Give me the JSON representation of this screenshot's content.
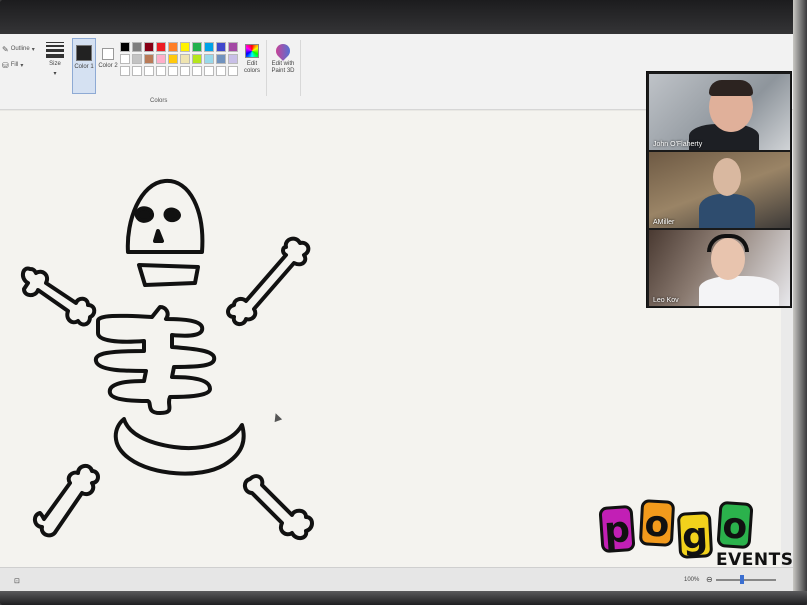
{
  "ribbon": {
    "outline_label": "Outline",
    "fill_label": "Fill",
    "size_label": "Size",
    "color1_label": "Color 1",
    "color2_label": "Color 2",
    "colors_group_label": "Colors",
    "edit_colors_label": "Edit colors",
    "paint3d_label": "Edit with Paint 3D",
    "color1_value": "#222222",
    "color2_value": "#ffffff",
    "palette": [
      "#000000",
      "#7f7f7f",
      "#880015",
      "#ed1c24",
      "#ff7f27",
      "#fff200",
      "#22b14c",
      "#00a2e8",
      "#3f48cc",
      "#a349a4",
      "#ffffff",
      "#c3c3c3",
      "#b97a57",
      "#ffaec9",
      "#ffc90e",
      "#efe4b0",
      "#b5e61d",
      "#99d9ea",
      "#7092be",
      "#c8bfe7",
      "#ffffff",
      "#ffffff",
      "#ffffff",
      "#ffffff",
      "#ffffff",
      "#ffffff",
      "#ffffff",
      "#ffffff",
      "#ffffff",
      "#ffffff"
    ]
  },
  "status": {
    "zoom": "100%"
  },
  "video_call": {
    "participants": [
      {
        "name": "John O'Flaherty"
      },
      {
        "name": "AMiller"
      },
      {
        "name": "Leo Kov"
      }
    ]
  },
  "logo": {
    "letters": [
      "p",
      "o",
      "g",
      "o"
    ],
    "letter_colors": [
      "#c21fb5",
      "#f29a1c",
      "#f2d21c",
      "#2bb24c"
    ],
    "events": "EVENTS"
  }
}
